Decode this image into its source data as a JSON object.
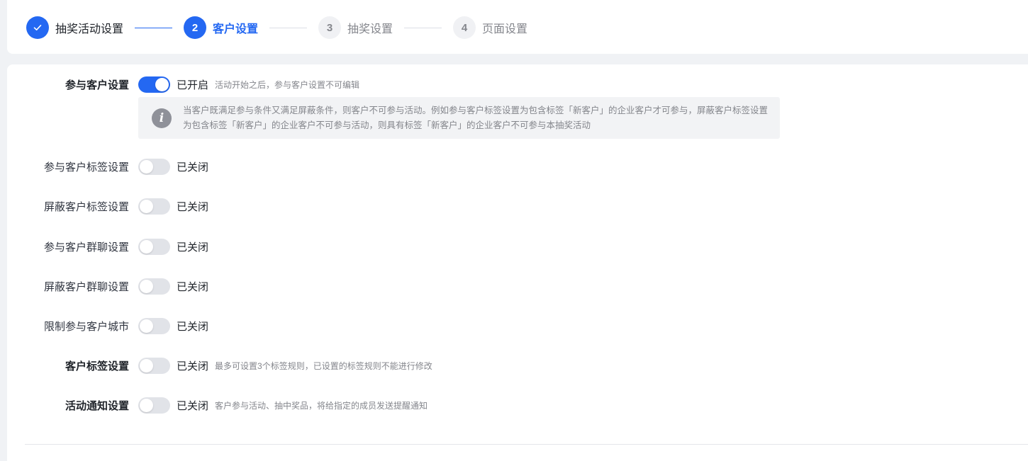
{
  "steps": [
    {
      "number": "✓",
      "label": "抽奖活动设置",
      "state": "done"
    },
    {
      "number": "2",
      "label": "客户设置",
      "state": "active"
    },
    {
      "number": "3",
      "label": "抽奖设置",
      "state": "pending"
    },
    {
      "number": "4",
      "label": "页面设置",
      "state": "pending"
    }
  ],
  "form": {
    "participant": {
      "label": "参与客户设置",
      "status": "已开启",
      "hint": "活动开始之后，参与客户设置不可编辑",
      "enabled": true
    },
    "notice": {
      "icon": "info-icon",
      "text": "当客户既满足参与条件又满足屏蔽条件，则客户不可参与活动。例如参与客户标签设置为包含标签「新客户」的企业客户才可参与，屏蔽客户标签设置为包含标签「新客户」的企业客户不可参与活动，则具有标签「新客户」的企业客户不可参与本抽奖活动"
    },
    "participant_tag": {
      "label": "参与客户标签设置",
      "status": "已关闭",
      "enabled": false
    },
    "blocked_tag": {
      "label": "屏蔽客户标签设置",
      "status": "已关闭",
      "enabled": false
    },
    "participant_group": {
      "label": "参与客户群聊设置",
      "status": "已关闭",
      "enabled": false
    },
    "blocked_group": {
      "label": "屏蔽客户群聊设置",
      "status": "已关闭",
      "enabled": false
    },
    "city_limit": {
      "label": "限制参与客户城市",
      "status": "已关闭",
      "enabled": false
    },
    "customer_tag": {
      "label": "客户标签设置",
      "status": "已关闭",
      "hint": "最多可设置3个标签规则，已设置的标签规则不能进行修改",
      "enabled": false
    },
    "notification": {
      "label": "活动通知设置",
      "status": "已关闭",
      "hint": "客户参与活动、抽中奖品，将给指定的成员发送提醒通知",
      "enabled": false
    }
  },
  "colors": {
    "primary": "#2468f2",
    "switch_off": "#e1e3e8",
    "hint_text": "#84868c",
    "notice_bg": "#f2f3f5"
  }
}
